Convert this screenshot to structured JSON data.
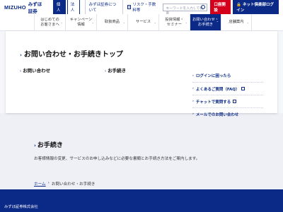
{
  "header": {
    "logo_mark": "MIZUHO",
    "logo_text": "みずほ証券",
    "segments": [
      "個人",
      "法人"
    ],
    "active_segment": "個人",
    "about_label": "みずほ証券について",
    "risk_label": "リスク・手数料等",
    "search_placeholder": "キーワードを入力して検索",
    "open_account_label": "口座開設",
    "login_label": "ネット倶楽部ログイン"
  },
  "nav": {
    "items": [
      {
        "label_line1": "はじめての",
        "label_line2": "お客さまへ"
      },
      {
        "label_line1": "キャンペーン",
        "label_line2": "情報"
      },
      {
        "label_line1": "取扱商品",
        "label_line2": ""
      },
      {
        "label_line1": "サービス",
        "label_line2": ""
      },
      {
        "label_line1": "投資情報・",
        "label_line2": "セミナー"
      },
      {
        "label_line1": "お問い合わせ・",
        "label_line2": "お手続き"
      },
      {
        "label_line1": "店舗案内",
        "label_line2": ""
      }
    ],
    "selected_index": 5
  },
  "dropdown": {
    "title": "お問い合わせ・お手続きトップ",
    "links": [
      "お問い合わせ",
      "お手続き"
    ],
    "side_links": [
      {
        "label": "ログインに困ったら",
        "external": false
      },
      {
        "label": "よくあるご質問（FAQ）",
        "external": true
      },
      {
        "label": "チャットで質問する",
        "external": true
      },
      {
        "label": "メールでのお問い合わせ",
        "external": false
      }
    ]
  },
  "main": {
    "section_title": "お手続き",
    "section_desc": "お客様情報の変更、サービスのお申し込みなどに必要な書類とお手続き方法をご案内します。",
    "breadcrumb": [
      "ホーム",
      "お問い合わせ・お手続き"
    ]
  },
  "footer": {
    "company": "みずほ証券株式会社"
  },
  "colors": {
    "brand_navy": "#0b2a87",
    "accent_red": "#d4001b"
  }
}
